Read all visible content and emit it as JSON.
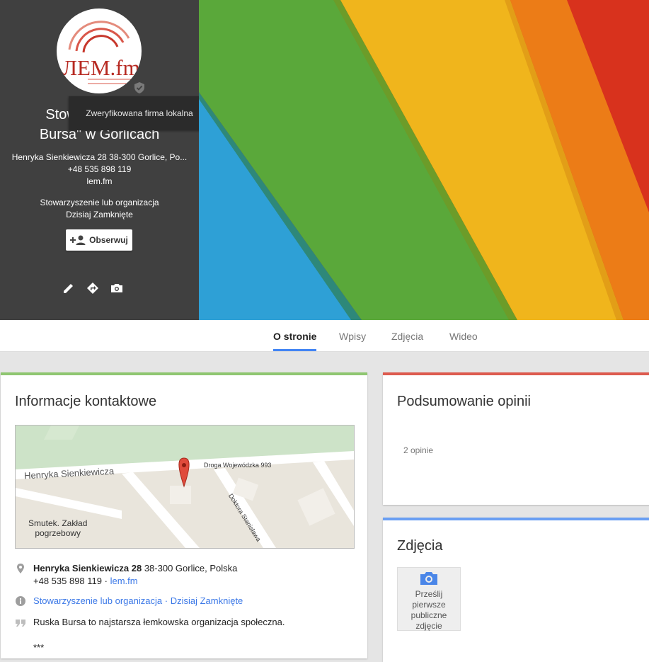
{
  "header": {
    "logo_text": "ЛEM.fm",
    "name_line1": "Stowar",
    "name_line2": "Bursa\" w Gorlicach",
    "tooltip": "Zweryfikowana firma lokalna",
    "address": "Henryka Sienkiewicza 28 38-300 Gorlice, Po...",
    "phone": "+48 535 898 119",
    "website": "lem.fm",
    "category": "Stowarzyszenie lub organizacja",
    "hours": "Dzisiaj Zamknięte",
    "follow_label": "Obserwuj",
    "icons": [
      "pencil-icon",
      "directions-icon",
      "camera-icon"
    ]
  },
  "tabs": [
    {
      "label": "O stronie",
      "active": true
    },
    {
      "label": "Wpisy"
    },
    {
      "label": "Zdjęcia"
    },
    {
      "label": "Wideo"
    }
  ],
  "contact": {
    "title": "Informacje kontaktowe",
    "map": {
      "street_main": "Henryka Sienkiewicza",
      "street_road": "Droga Wojewódzka 993",
      "street_side": "Doktora Stanisława",
      "poi": "Smutek. Zakład\npogrzebowy"
    },
    "address_bold": "Henryka Sienkiewicza 28",
    "address_rest": "38-300 Gorlice, Polska",
    "phone": "+48 535 898 119",
    "separator": "·",
    "website": "lem.fm",
    "category": "Stowarzyszenie lub organizacja",
    "hours": "Dzisiaj Zamknięte",
    "description": "Ruska Bursa to najstarsza łemkowska organizacja społeczna.",
    "more": "***"
  },
  "reviews": {
    "title": "Podsumowanie opinii",
    "count": "2 opinie"
  },
  "photos": {
    "title": "Zdjęcia",
    "upload_label": "Prześlij pierwsze publiczne zdjęcie"
  },
  "colors": {
    "header_bg": "#404040",
    "green_accent": "#8fc671",
    "red_accent": "#dd5b4f",
    "blue_accent": "#6a9ff3",
    "link": "#3b78e7"
  }
}
